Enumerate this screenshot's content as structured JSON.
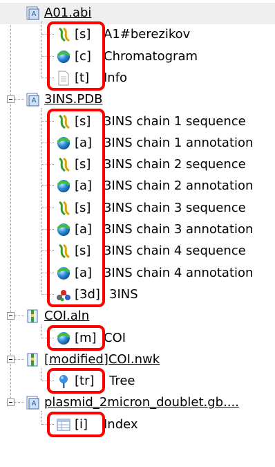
{
  "tree": [
    {
      "name": "A01.abi",
      "icon": "project-document-icon",
      "children": [
        {
          "type": "[s]",
          "name": "A1#berezikov",
          "icon": "sequence-icon"
        },
        {
          "type": "[c]",
          "name": "Chromatogram",
          "icon": "annotation-ball-icon"
        },
        {
          "type": "[t]",
          "name": "Info",
          "icon": "text-file-icon"
        }
      ]
    },
    {
      "name": "3INS.PDB",
      "icon": "project-document-icon",
      "children": [
        {
          "type": "[s]",
          "name": "3INS chain 1 sequence",
          "icon": "sequence-icon"
        },
        {
          "type": "[a]",
          "name": "3INS chain 1 annotation",
          "icon": "annotation-ball-icon"
        },
        {
          "type": "[s]",
          "name": "3INS chain 2 sequence",
          "icon": "sequence-icon"
        },
        {
          "type": "[a]",
          "name": "3INS chain 2 annotation",
          "icon": "annotation-ball-icon"
        },
        {
          "type": "[s]",
          "name": "3INS chain 3 sequence",
          "icon": "sequence-icon"
        },
        {
          "type": "[a]",
          "name": "3INS chain 3 annotation",
          "icon": "annotation-ball-icon"
        },
        {
          "type": "[s]",
          "name": "3INS chain 4 sequence",
          "icon": "sequence-icon"
        },
        {
          "type": "[a]",
          "name": "3INS chain 4 annotation",
          "icon": "annotation-ball-icon"
        },
        {
          "type": "[3d]",
          "name": "3INS",
          "icon": "molecule-3d-icon"
        }
      ]
    },
    {
      "name": "COI.aln",
      "icon": "alignment-document-icon",
      "children": [
        {
          "type": "[m]",
          "name": "COI",
          "icon": "annotation-ball-icon"
        }
      ]
    },
    {
      "name": "[modified]COI.nwk",
      "icon": "alignment-document-icon",
      "children": [
        {
          "type": "[tr]",
          "name": "Tree",
          "icon": "tree-icon"
        }
      ]
    },
    {
      "name": "plasmid_2micron_doublet.gb....",
      "icon": "project-document-icon",
      "children": [
        {
          "type": "[i]",
          "name": "Index",
          "icon": "index-table-icon"
        }
      ]
    }
  ]
}
